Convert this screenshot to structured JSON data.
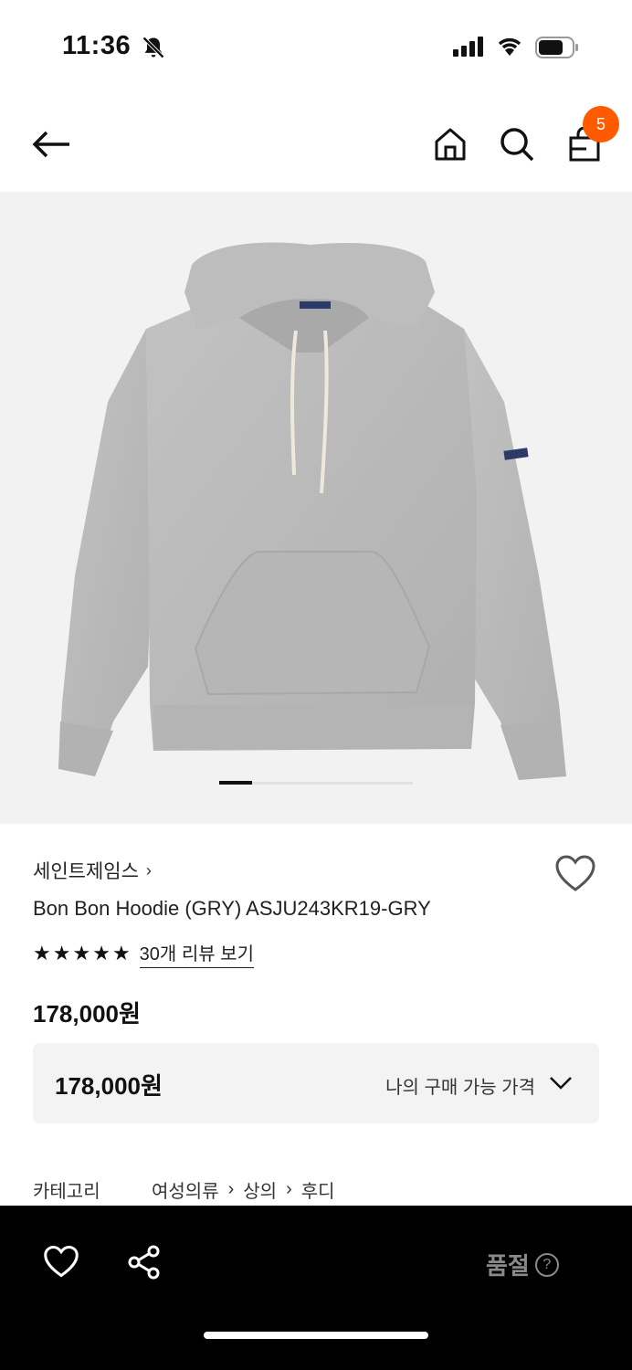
{
  "status_bar": {
    "time": "11:36"
  },
  "nav": {
    "cart_count": "5"
  },
  "product": {
    "brand": "세인트제임스",
    "name": "Bon Bon Hoodie (GRY) ASJU243KR19-GRY",
    "rating_stars": 5,
    "review_link": "30개 리뷰 보기",
    "price": "178,000원",
    "my_price": "178,000원",
    "my_price_label": "나의 구매 가능 가격",
    "image_index": 1
  },
  "category": {
    "label": "카테고리",
    "path": [
      "여성의류",
      "상의",
      "후디"
    ]
  },
  "bottom": {
    "status": "품절",
    "help": "?"
  },
  "colors": {
    "accent": "#ff5a00",
    "hoodie": "#b9b9b9",
    "bottom_bar": "#000000"
  }
}
